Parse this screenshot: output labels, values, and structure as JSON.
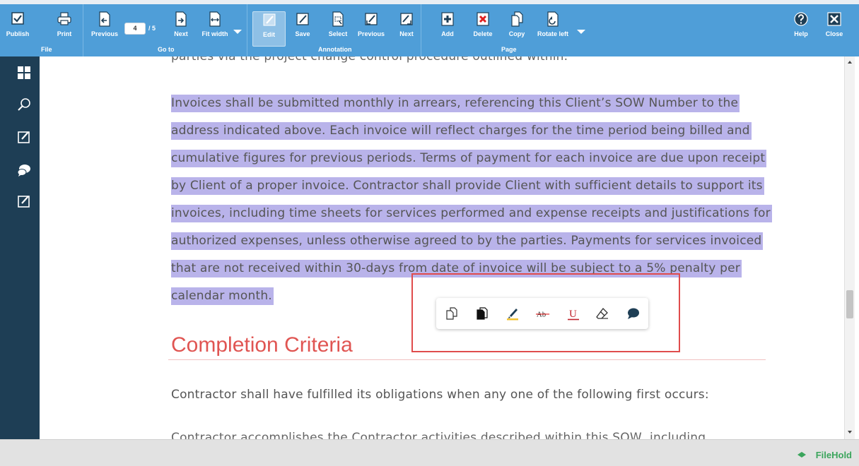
{
  "toolbar": {
    "file": {
      "group_label": "File",
      "publish": "Publish",
      "print": "Print"
    },
    "goto": {
      "group_label": "Go to",
      "previous": "Previous",
      "page_value": "4",
      "page_total": "/ 5",
      "next": "Next",
      "fit_width": "Fit width"
    },
    "annotation": {
      "group_label": "Annotation",
      "edit": "Edit",
      "save": "Save",
      "select": "Select",
      "previous": "Previous",
      "next": "Next"
    },
    "page": {
      "group_label": "Page",
      "add": "Add",
      "delete": "Delete",
      "copy": "Copy",
      "rotate_left": "Rotate left"
    },
    "help": "Help",
    "close": "Close"
  },
  "sidebar": {
    "items": [
      "thumbnails-icon",
      "search-icon",
      "edit-icon",
      "comments-icon",
      "annotate-icon"
    ]
  },
  "document": {
    "cut_top_line": "parties via the project change control procedure outlined within.",
    "paragraph_lines": [
      "Invoices shall be submitted monthly in arrears, referencing this Client’s SOW Number to the",
      "address indicated above. Each invoice will reflect charges for the time period being billed and",
      "cumulative figures for previous periods. Terms of payment for each invoice are due upon receipt",
      "by Client of a proper invoice. Contractor shall provide Client with sufficient details to support its",
      "invoices, including time sheets for services performed and expense receipts and justifications for",
      "authorized expenses, unless otherwise agreed to by the parties. Payments for services invoiced",
      "that are not received within 30-days from date of invoice will be subject to a 5% penalty per",
      "calendar month."
    ],
    "heading": "Completion Criteria",
    "after_heading": "Contractor shall have fulfilled its obligations when any one of the following first occurs:",
    "cut_bottom_line": "Contractor accomplishes the Contractor activities described within this SOW, including"
  },
  "annotation_bar": {
    "tools": [
      "copy-icon",
      "fill-icon",
      "highlight-icon",
      "strikethrough-icon",
      "underline-icon",
      "eraser-icon",
      "comment-icon"
    ],
    "strikethrough_label": "Ab",
    "underline_label": "U"
  },
  "footer": {
    "brand": "FileHold"
  },
  "colors": {
    "toolbar": "#4f9ed8",
    "sidebar": "#1e3e55",
    "highlight": "#b9b3ea",
    "heading": "#e05552",
    "selection_box": "#e04c4c",
    "brand": "#3ba55c"
  }
}
